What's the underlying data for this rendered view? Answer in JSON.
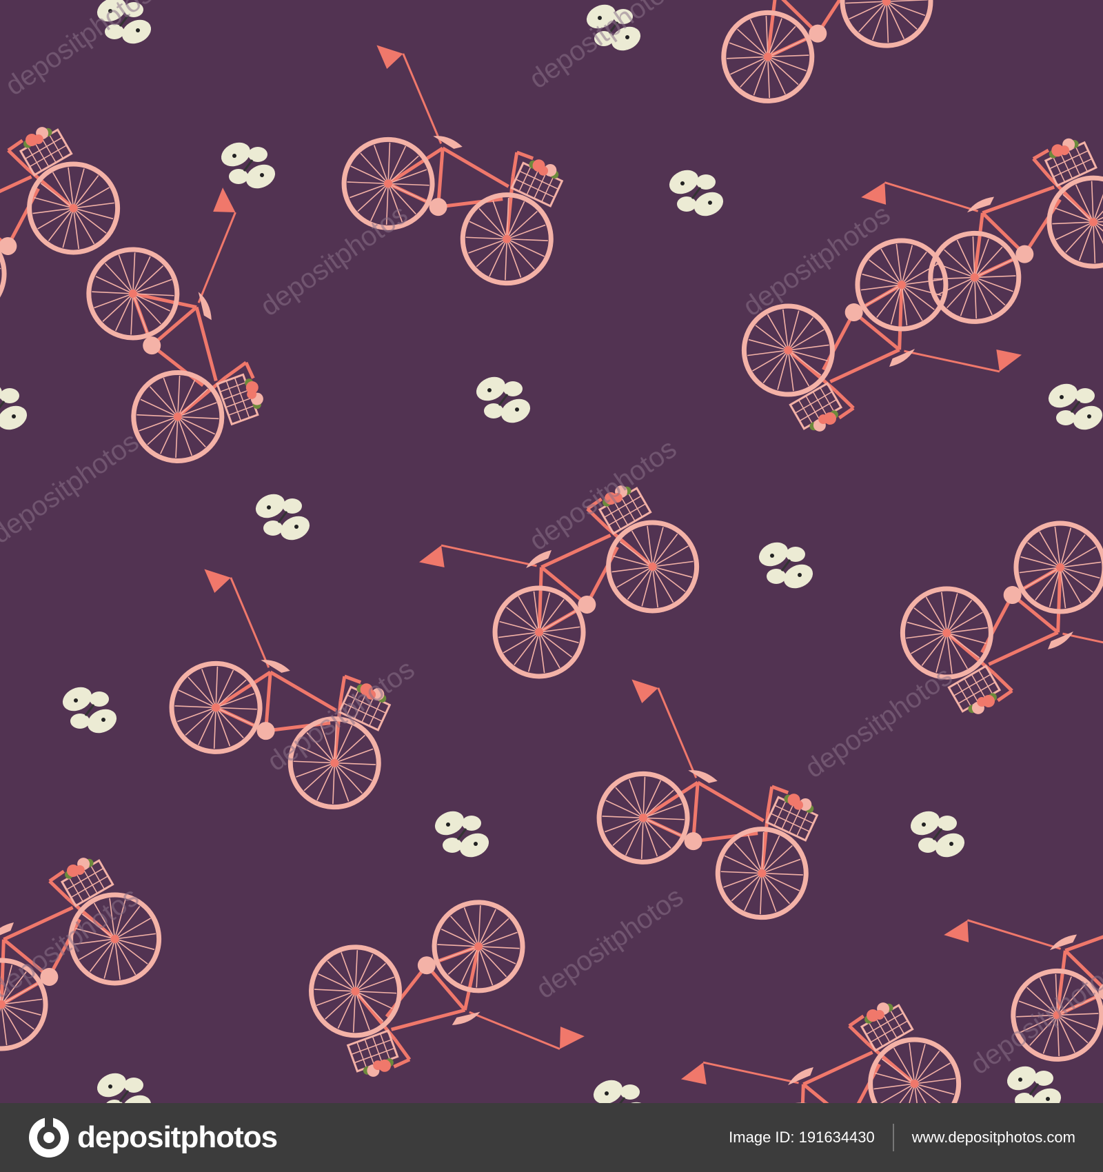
{
  "image": {
    "description_colors": {
      "background": "#523352",
      "wheel": "#f4b2a7",
      "frame": "#f0786b",
      "flag": "#f0786b",
      "butterfly": "#ecebd4",
      "watermark": "#8a7289"
    },
    "watermark_text": "depositphotos"
  },
  "footer": {
    "logo_icon": "depositphotos-logo-icon",
    "logo_text": "depositphotos",
    "image_id": "Image ID: 191634430",
    "site_url": "www.depositphotos.com"
  }
}
